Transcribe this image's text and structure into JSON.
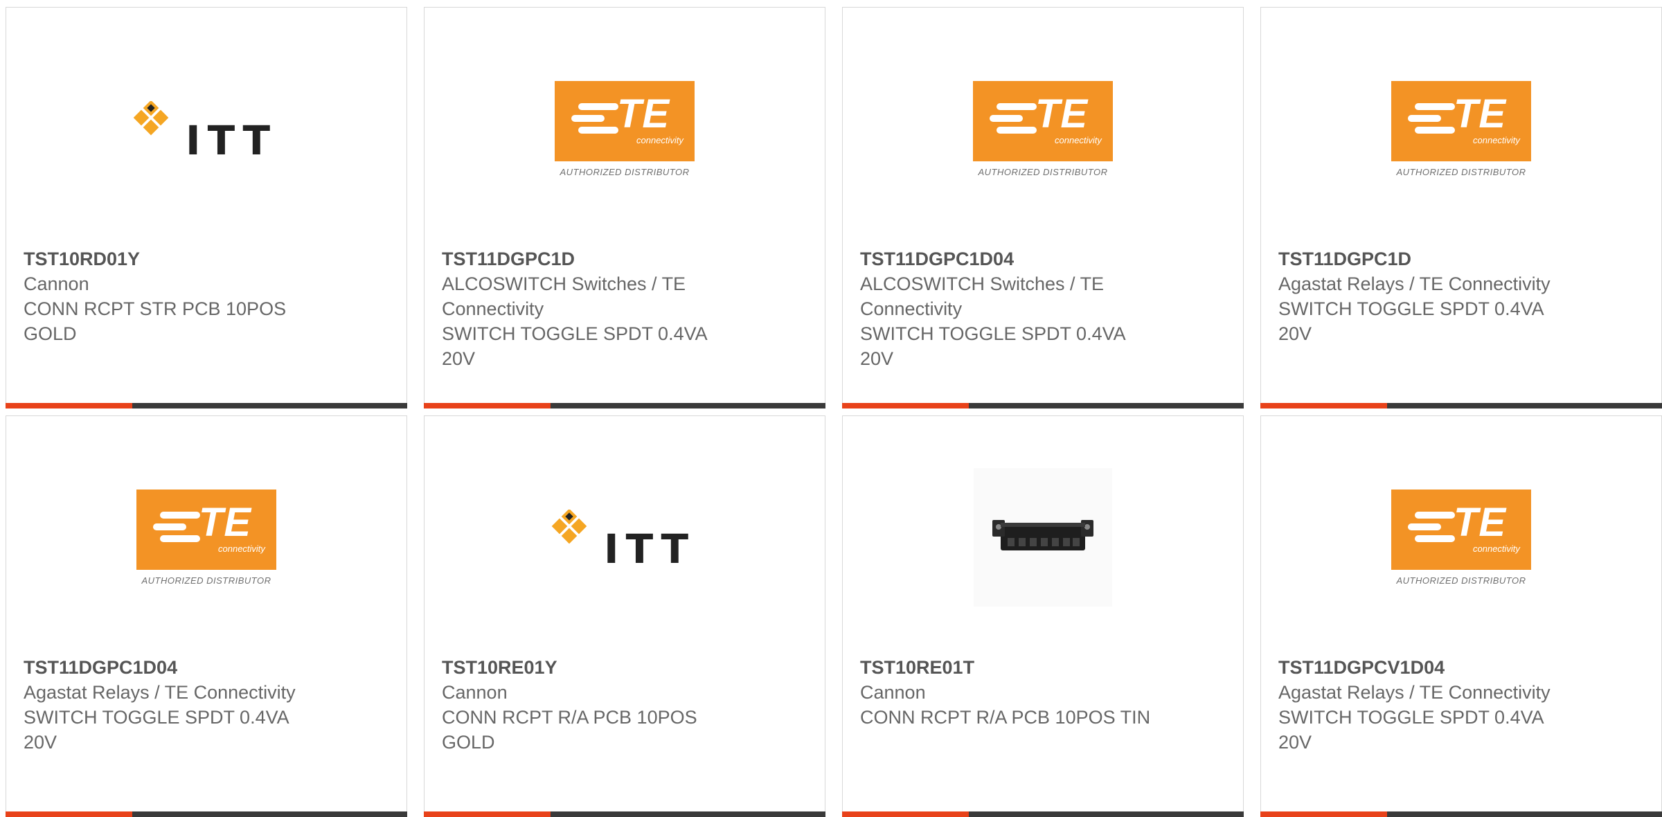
{
  "cards": [
    {
      "pn": "TST10RD01Y",
      "mfr": "Cannon",
      "desc": "CONN RCPT STR PCB 10POS GOLD",
      "logo": "itt-logo"
    },
    {
      "pn": "TST11DGPC1D",
      "mfr": "ALCOSWITCH Switches / TE Connectivity",
      "desc": "SWITCH TOGGLE SPDT 0.4VA 20V",
      "logo": "te-logo"
    },
    {
      "pn": "TST11DGPC1D04",
      "mfr": "ALCOSWITCH Switches / TE Connectivity",
      "desc": "SWITCH TOGGLE SPDT 0.4VA 20V",
      "logo": "te-logo"
    },
    {
      "pn": "TST11DGPC1D",
      "mfr": "Agastat Relays / TE Connectivity",
      "desc": "SWITCH TOGGLE SPDT 0.4VA 20V",
      "logo": "te-logo"
    },
    {
      "pn": "TST11DGPC1D04",
      "mfr": "Agastat Relays / TE Connectivity",
      "desc": "SWITCH TOGGLE SPDT 0.4VA 20V",
      "logo": "te-logo"
    },
    {
      "pn": "TST10RE01Y",
      "mfr": "Cannon",
      "desc": "CONN RCPT R/A PCB 10POS GOLD",
      "logo": "itt-logo"
    },
    {
      "pn": "TST10RE01T",
      "mfr": "Cannon",
      "desc": "CONN RCPT R/A PCB 10POS TIN",
      "logo": "connector-photo"
    },
    {
      "pn": "TST11DGPCV1D04",
      "mfr": "Agastat Relays / TE Connectivity",
      "desc": "SWITCH TOGGLE SPDT 0.4VA 20V",
      "logo": "te-logo"
    }
  ],
  "logos": {
    "itt": "ITT",
    "te": "TE",
    "te_sub": "connectivity",
    "te_authorized": "AUTHORIZED DISTRIBUTOR"
  },
  "colors": {
    "accent": "#e8421a",
    "bar": "#3a3a3a",
    "te_orange": "#f39325"
  }
}
